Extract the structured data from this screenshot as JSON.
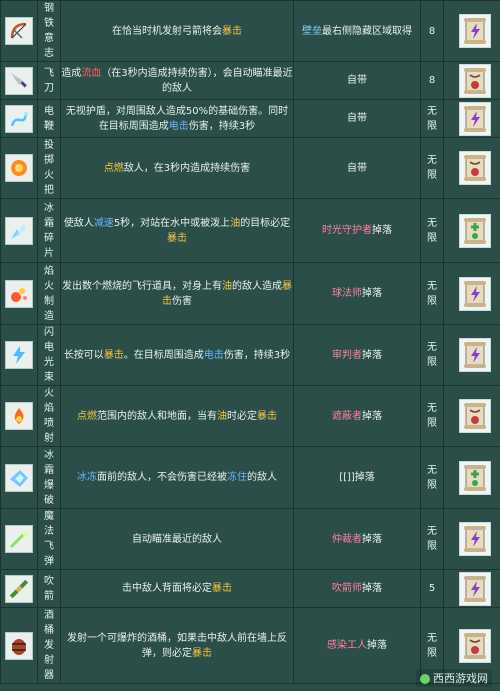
{
  "rows": [
    {
      "name": "钢铁意志",
      "desc_parts": [
        [
          "在恰当时机发射弓箭将会",
          ""
        ],
        [
          "暴击",
          "hl-orange"
        ]
      ],
      "source_parts": [
        [
          "壁垒",
          "src-name-blue"
        ],
        [
          "最右侧隐藏区域取得",
          ""
        ]
      ],
      "count": "8",
      "icon": "bow-icon",
      "scroll": "purple"
    },
    {
      "name": "飞刀",
      "desc_parts": [
        [
          "造成",
          ""
        ],
        [
          "流血",
          "hl-red"
        ],
        [
          "（在3秒内造成持续伤害），会自动瞄准最近的敌人",
          ""
        ]
      ],
      "source_parts": [
        [
          "自带",
          ""
        ]
      ],
      "count": "8",
      "icon": "knife-icon",
      "scroll": "red"
    },
    {
      "name": "电鞭",
      "desc_parts": [
        [
          "无视护盾，对周围敌人造成50%的基础伤害。同时在目标周围造成",
          ""
        ],
        [
          "电击",
          "hl-blue"
        ],
        [
          "伤害，持续3秒",
          ""
        ]
      ],
      "source_parts": [
        [
          "自带",
          ""
        ]
      ],
      "count": "无限",
      "icon": "whip-icon",
      "scroll": "purple"
    },
    {
      "name": "投掷火把",
      "desc_parts": [
        [
          "点燃",
          "hl-orange"
        ],
        [
          "敌人，在3秒内造成持续伤害",
          ""
        ]
      ],
      "source_parts": [
        [
          "自带",
          ""
        ]
      ],
      "count": "无限",
      "icon": "torch-icon",
      "scroll": "red"
    },
    {
      "name": "冰霜碎片",
      "desc_parts": [
        [
          "使敌人",
          ""
        ],
        [
          "减速",
          "hl-blue"
        ],
        [
          "5秒，对站在水中或被泼上",
          ""
        ],
        [
          "油",
          "hl-orange"
        ],
        [
          "的目标必定",
          ""
        ],
        [
          "暴击",
          "hl-orange"
        ]
      ],
      "source_parts": [
        [
          "时光守护者",
          "src-name-pink"
        ],
        [
          "掉落",
          ""
        ]
      ],
      "count": "无限",
      "icon": "ice-shard-icon",
      "scroll": "green"
    },
    {
      "name": "焰火制造",
      "desc_parts": [
        [
          "发出数个燃烧的飞行道具，对身上有",
          ""
        ],
        [
          "油",
          "hl-orange"
        ],
        [
          "的敌人造成",
          ""
        ],
        [
          "暴击",
          "hl-orange"
        ],
        [
          "伤害",
          ""
        ]
      ],
      "source_parts": [
        [
          "球法师",
          "src-name-pink"
        ],
        [
          "掉落",
          ""
        ]
      ],
      "count": "无限",
      "icon": "firework-icon",
      "scroll": "purple"
    },
    {
      "name": "闪电光束",
      "desc_parts": [
        [
          "长按可以",
          ""
        ],
        [
          "暴击",
          "hl-orange"
        ],
        [
          "。在目标周围造成",
          ""
        ],
        [
          "电击",
          "hl-blue"
        ],
        [
          "伤害，持续3秒",
          ""
        ]
      ],
      "source_parts": [
        [
          "审判者",
          "src-name-pink"
        ],
        [
          "掉落",
          ""
        ]
      ],
      "count": "无限",
      "icon": "lightning-icon",
      "scroll": "purple"
    },
    {
      "name": "火焰喷射",
      "desc_parts": [
        [
          "点燃",
          "hl-orange"
        ],
        [
          "范围内的敌人和地面，当有",
          ""
        ],
        [
          "油",
          "hl-orange"
        ],
        [
          "时必定",
          ""
        ],
        [
          "暴击",
          "hl-orange"
        ]
      ],
      "source_parts": [
        [
          "遮蔽者",
          "src-name-pink"
        ],
        [
          "掉落",
          ""
        ]
      ],
      "count": "无限",
      "icon": "flame-icon",
      "scroll": "red"
    },
    {
      "name": "冰霜爆破",
      "desc_parts": [
        [
          "冰冻",
          "hl-blue"
        ],
        [
          "面前的敌人，不会伤害已经被",
          ""
        ],
        [
          "冻住",
          "hl-blue"
        ],
        [
          "的敌人",
          ""
        ]
      ],
      "source_parts": [
        [
          "[[]]掉落",
          ""
        ]
      ],
      "count": "无限",
      "icon": "ice-blast-icon",
      "scroll": "green"
    },
    {
      "name": "魔法飞弹",
      "desc_parts": [
        [
          "自动瞄准最近的敌人",
          ""
        ]
      ],
      "source_parts": [
        [
          "仲裁者",
          "src-name-pink"
        ],
        [
          "掉落",
          ""
        ]
      ],
      "count": "无限",
      "icon": "magic-missile-icon",
      "scroll": "purple"
    },
    {
      "name": "吹箭",
      "desc_parts": [
        [
          "击中敌人背面将必定",
          ""
        ],
        [
          "暴击",
          "hl-orange"
        ]
      ],
      "source_parts": [
        [
          "吹箭师",
          "src-name-pink"
        ],
        [
          "掉落",
          ""
        ]
      ],
      "count": "5",
      "icon": "blowgun-icon",
      "scroll": "purple"
    },
    {
      "name": "酒桶发射器",
      "desc_parts": [
        [
          "发射一个可爆炸的酒桶，如果击中敌人前在墙上反弹，则必定",
          ""
        ],
        [
          "暴击",
          "hl-orange"
        ]
      ],
      "source_parts": [
        [
          "感染工人",
          "src-name-pink"
        ],
        [
          "掉落",
          ""
        ]
      ],
      "count": "无限",
      "icon": "barrel-launcher-icon",
      "scroll": "red"
    }
  ],
  "watermark": "西西游戏网",
  "colors": {
    "background": "#2b4f48",
    "border": "#1a3530",
    "highlight_orange": "#f5c542",
    "highlight_red": "#ff5d5d",
    "highlight_blue": "#6fb3ff",
    "source_pink": "#ff7f9f",
    "source_blue": "#7fcfff"
  }
}
